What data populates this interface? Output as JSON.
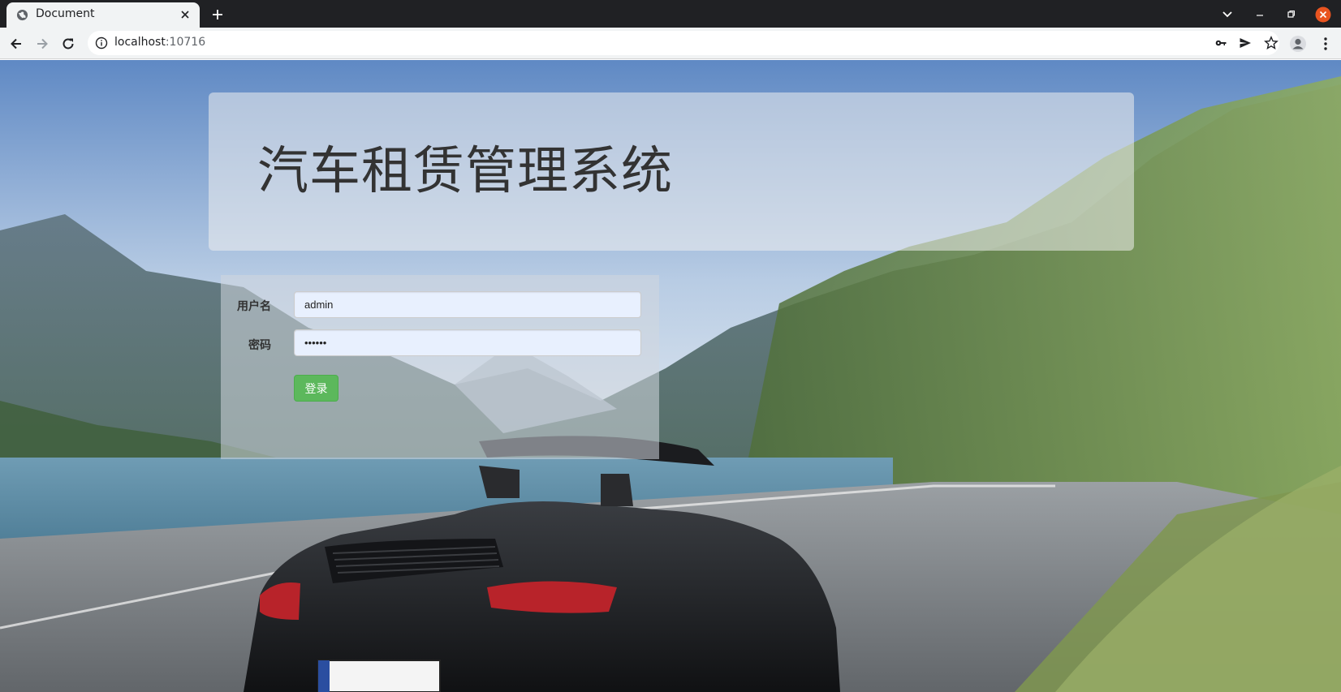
{
  "browser": {
    "tab_title": "Document",
    "url_host": "localhost",
    "url_port": ":10716",
    "icons": [
      "globe-icon",
      "close-icon",
      "plus-icon",
      "chevron-down-icon",
      "minimize-icon",
      "restore-icon",
      "window-close-icon",
      "back-arrow-icon",
      "forward-arrow-icon",
      "reload-icon",
      "info-icon",
      "key-icon",
      "send-icon",
      "star-icon",
      "profile-icon",
      "kebab-menu-icon"
    ]
  },
  "page": {
    "system_title": "汽车租赁管理系统",
    "form": {
      "username_label": "用户名",
      "username_value": "admin",
      "password_label": "密码",
      "password_value": "123456",
      "login_button": "登录"
    }
  },
  "colors": {
    "titlebar": "#202124",
    "toolbar": "#f1f3f4",
    "login_button": "#5cb85c",
    "autofill_input": "#e8f0fe",
    "window_close": "#e95420"
  }
}
